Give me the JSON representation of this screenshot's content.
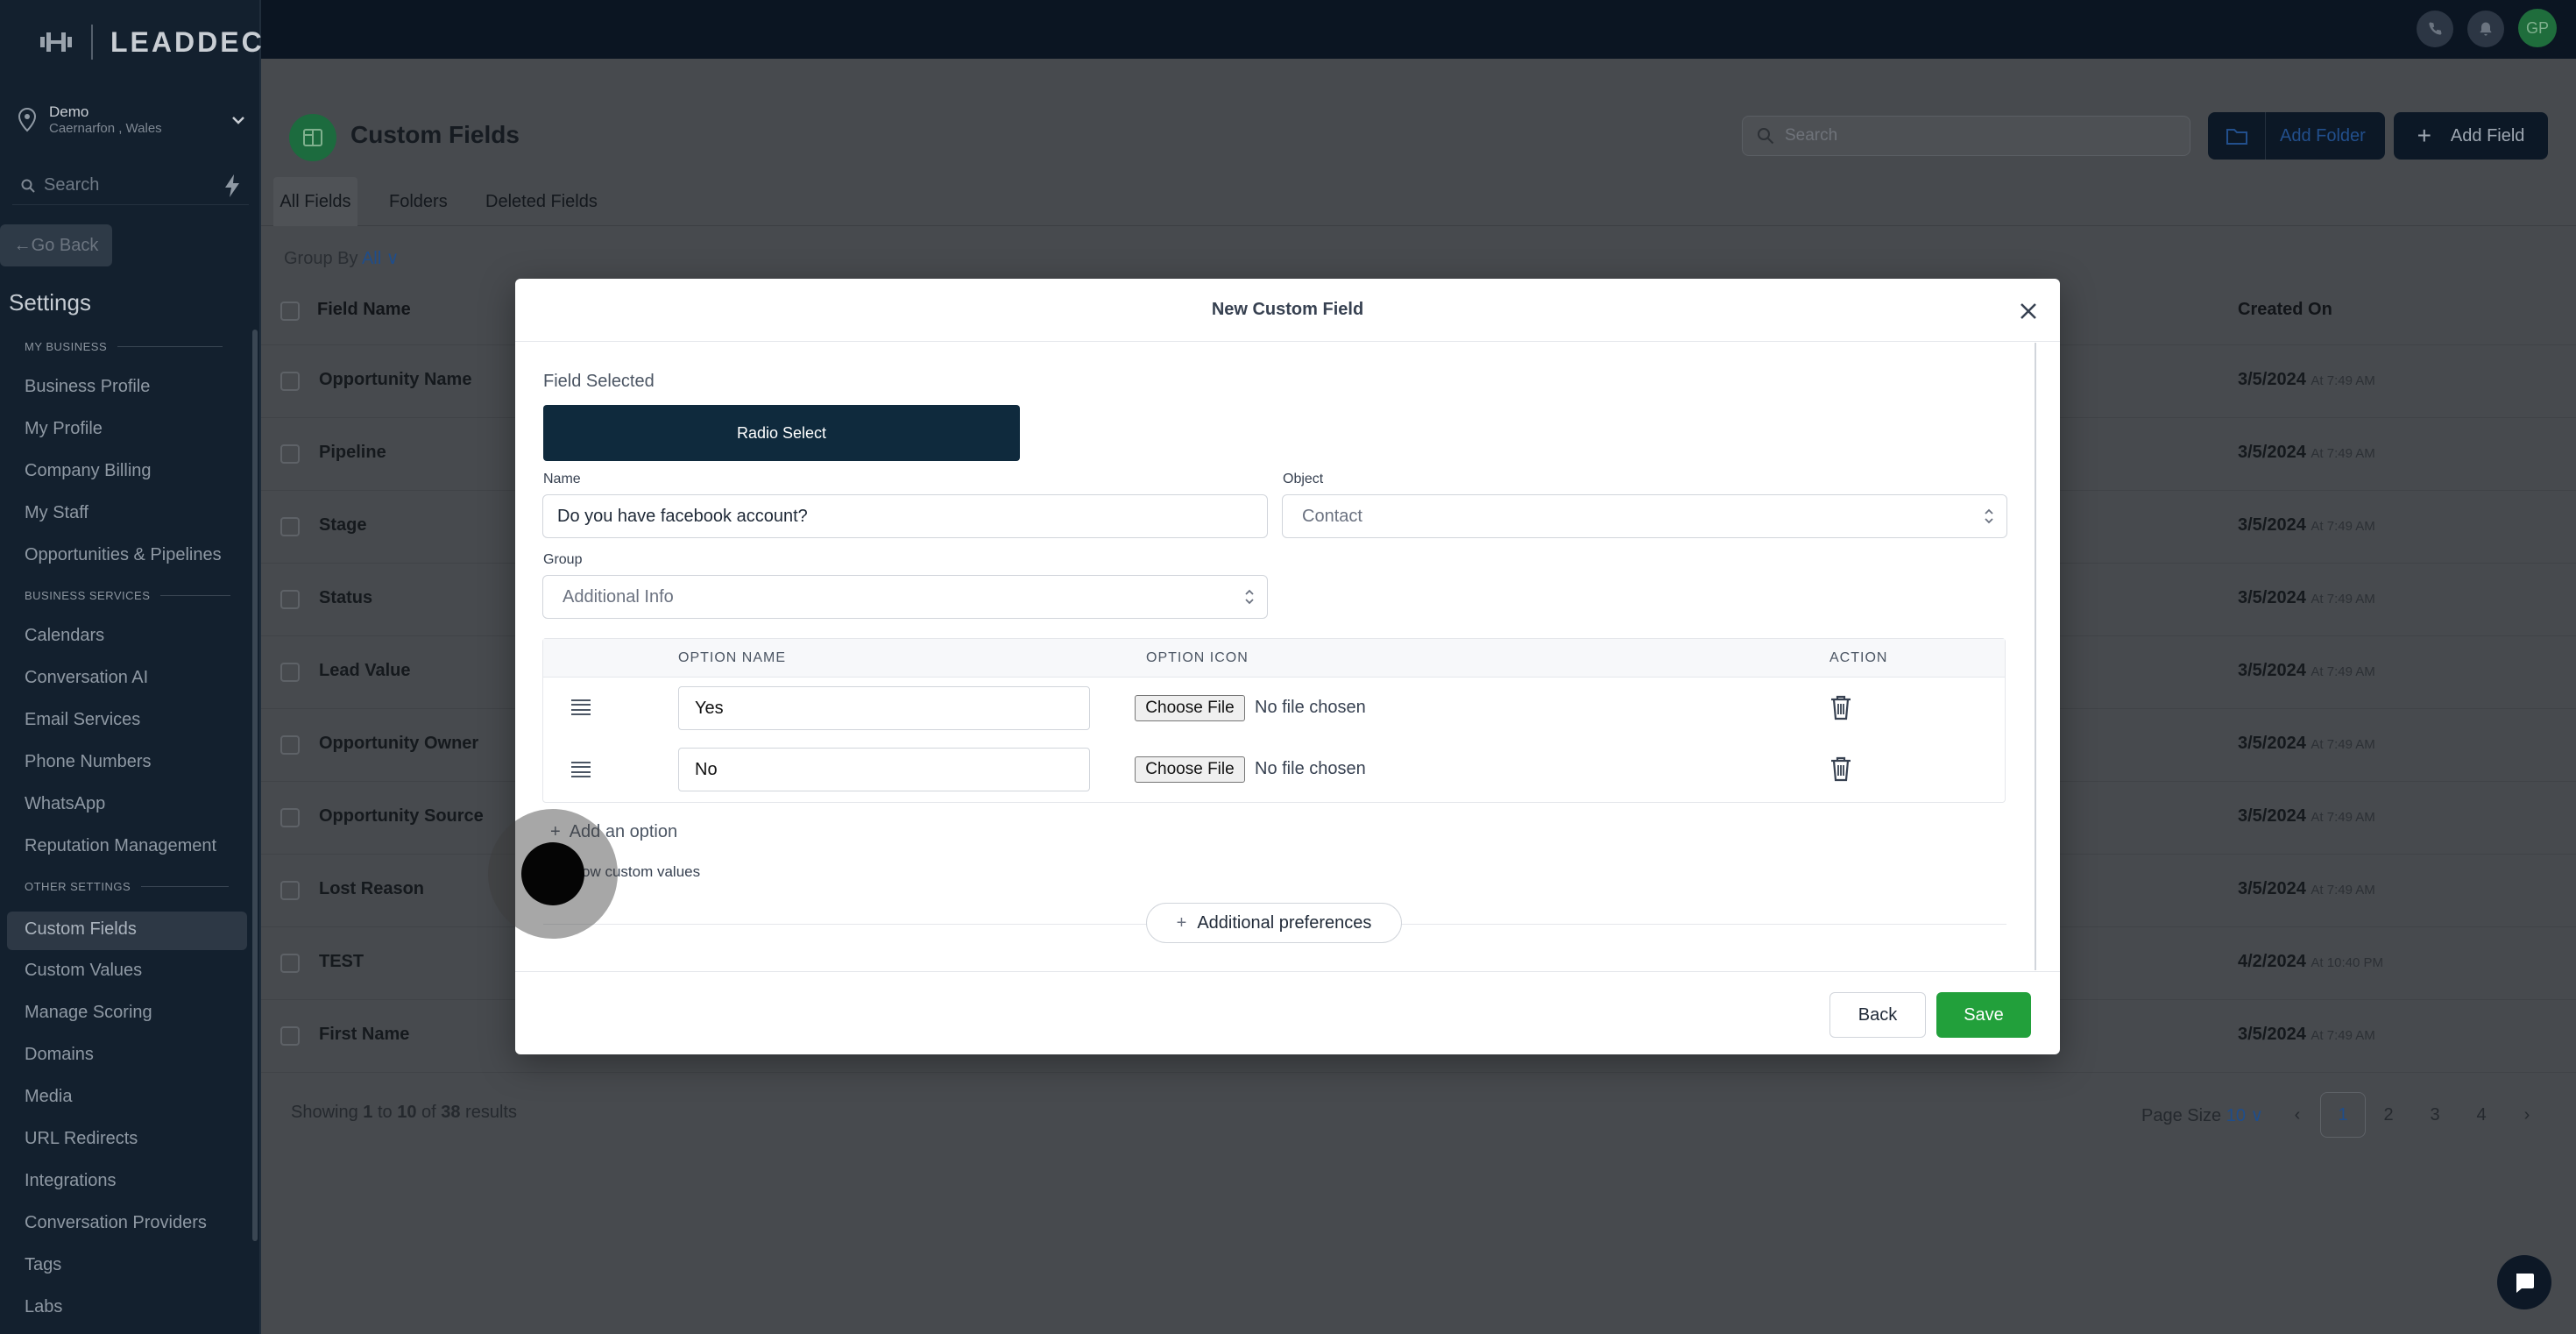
{
  "brand": {
    "logo_text": "LEADDEC"
  },
  "location": {
    "name": "Demo",
    "sub": "Caernarfon , Wales"
  },
  "sidebar": {
    "search_placeholder": "Search",
    "go_back": "Go Back",
    "title": "Settings",
    "sections": [
      {
        "label": "MY BUSINESS",
        "items": [
          "Business Profile",
          "My Profile",
          "Company Billing",
          "My Staff",
          "Opportunities & Pipelines"
        ]
      },
      {
        "label": "BUSINESS SERVICES",
        "items": [
          "Calendars",
          "Conversation AI",
          "Email Services",
          "Phone Numbers",
          "WhatsApp",
          "Reputation Management"
        ]
      },
      {
        "label": "OTHER SETTINGS",
        "items": [
          "Custom Fields",
          "Custom Values",
          "Manage Scoring",
          "Domains",
          "Media",
          "URL Redirects",
          "Integrations",
          "Conversation Providers",
          "Tags",
          "Labs"
        ]
      }
    ],
    "active_item": "Custom Fields"
  },
  "topbar": {
    "avatar": "GP"
  },
  "page": {
    "title": "Custom Fields",
    "search_placeholder": "Search",
    "add_folder": "Add Folder",
    "add_field": "Add Field",
    "tabs": [
      "All Fields",
      "Folders",
      "Deleted Fields"
    ],
    "active_tab": "All Fields",
    "group_by_label": "Group By",
    "group_by_value": "All"
  },
  "table": {
    "headers": {
      "name": "Field Name",
      "created": "Created On"
    },
    "rows": [
      {
        "name": "Opportunity Name",
        "date": "3/5/2024",
        "time": "At 7:49 AM"
      },
      {
        "name": "Pipeline",
        "date": "3/5/2024",
        "time": "At 7:49 AM"
      },
      {
        "name": "Stage",
        "date": "3/5/2024",
        "time": "At 7:49 AM"
      },
      {
        "name": "Status",
        "date": "3/5/2024",
        "time": "At 7:49 AM"
      },
      {
        "name": "Lead Value",
        "date": "3/5/2024",
        "time": "At 7:49 AM"
      },
      {
        "name": "Opportunity Owner",
        "date": "3/5/2024",
        "time": "At 7:49 AM"
      },
      {
        "name": "Opportunity Source",
        "date": "3/5/2024",
        "time": "At 7:49 AM"
      },
      {
        "name": "Lost Reason",
        "date": "3/5/2024",
        "time": "At 7:49 AM"
      },
      {
        "name": "TEST",
        "date": "4/2/2024",
        "time": "At 10:40 PM"
      },
      {
        "name": "First Name",
        "date": "3/5/2024",
        "time": "At 7:49 AM"
      }
    ]
  },
  "footer": {
    "showing_a": "Showing ",
    "from": "1",
    "to_word": " to ",
    "to": "10",
    "of_word": " of ",
    "total": "38",
    "results": " results",
    "page_size_label": "Page Size",
    "page_size": "10",
    "pages": [
      "1",
      "2",
      "3",
      "4"
    ],
    "current_page": "1"
  },
  "modal": {
    "title": "New Custom Field",
    "field_selected_label": "Field Selected",
    "field_selected": "Radio Select",
    "name_label": "Name",
    "name_value": "Do you have facebook account?",
    "object_label": "Object",
    "object_value": "Contact",
    "group_label": "Group",
    "group_value": "Additional Info",
    "options_headers": {
      "name": "OPTION NAME",
      "icon": "OPTION ICON",
      "action": "ACTION"
    },
    "options": [
      {
        "name": "Yes",
        "file_button": "Choose File",
        "file_status": "No file chosen"
      },
      {
        "name": "No",
        "file_button": "Choose File",
        "file_status": "No file chosen"
      }
    ],
    "add_option": "Add an option",
    "allow_custom_values": "ow custom values",
    "additional_preferences": "Additional preferences",
    "back": "Back",
    "save": "Save"
  },
  "colors": {
    "accent_green": "#22a03b",
    "dark_navy": "#0f2a3d",
    "link_blue": "#1f4d8a"
  }
}
